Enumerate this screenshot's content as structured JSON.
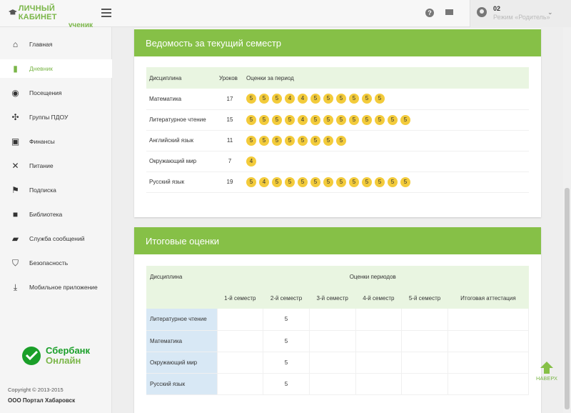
{
  "header": {
    "logo_line1": "ЛИЧНЫЙ КАБИНЕТ",
    "logo_line2": "ученик",
    "user_id": "02",
    "user_role": "Режим «Родитель»"
  },
  "sidebar": {
    "items": [
      {
        "label": "Главная",
        "icon": "home-icon"
      },
      {
        "label": "Дневник",
        "icon": "book-icon"
      },
      {
        "label": "Посещения",
        "icon": "attendance-icon"
      },
      {
        "label": "Группы ПДОУ",
        "icon": "groups-icon"
      },
      {
        "label": "Финансы",
        "icon": "wallet-icon"
      },
      {
        "label": "Питание",
        "icon": "food-icon"
      },
      {
        "label": "Подписка",
        "icon": "flag-icon"
      },
      {
        "label": "Библиотека",
        "icon": "library-icon"
      },
      {
        "label": "Служба сообщений",
        "icon": "messages-icon"
      },
      {
        "label": "Безопасность",
        "icon": "shield-icon"
      },
      {
        "label": "Мобильное приложение",
        "icon": "download-icon"
      }
    ],
    "active_index": 1,
    "sber_line1": "Сбербанк",
    "sber_line2": "Онлайн",
    "copyright": "Copyright © 2013-2015",
    "company": "ООО Портал Хабаровск"
  },
  "semester": {
    "title": "Ведомость за текущий семестр",
    "headers": [
      "Дисциплина",
      "Уроков",
      "Оценки за период"
    ],
    "rows": [
      {
        "subject": "Математика",
        "lessons": "17",
        "grades": [
          "5",
          "5",
          "5",
          "4",
          "4",
          "5",
          "5",
          "5",
          "5",
          "5",
          "5"
        ]
      },
      {
        "subject": "Литературное чтение",
        "lessons": "15",
        "grades": [
          "5",
          "5",
          "5",
          "5",
          "4",
          "5",
          "5",
          "5",
          "5",
          "5",
          "5",
          "5",
          "5"
        ]
      },
      {
        "subject": "Английский язык",
        "lessons": "11",
        "grades": [
          "5",
          "5",
          "5",
          "5",
          "5",
          "5",
          "5",
          "5"
        ]
      },
      {
        "subject": "Окружающий мир",
        "lessons": "7",
        "grades": [
          "4"
        ]
      },
      {
        "subject": "Русский язык",
        "lessons": "19",
        "grades": [
          "5",
          "4",
          "5",
          "5",
          "5",
          "5",
          "5",
          "5",
          "5",
          "5",
          "5",
          "5",
          "5"
        ]
      }
    ]
  },
  "final": {
    "title": "Итоговые оценки",
    "discipline_header": "Дисциплина",
    "periods_header": "Оценки периодов",
    "period_headers": [
      "1-й семестр",
      "2-й семестр",
      "3-й семестр",
      "4-й семестр",
      "5-й семестр",
      "Итоговая аттестация"
    ],
    "rows": [
      {
        "subject": "Литературное чтение",
        "cells": [
          "",
          "5",
          "",
          "",
          "",
          ""
        ]
      },
      {
        "subject": "Математика",
        "cells": [
          "",
          "5",
          "",
          "",
          "",
          ""
        ]
      },
      {
        "subject": "Окружающий мир",
        "cells": [
          "",
          "5",
          "",
          "",
          "",
          ""
        ]
      },
      {
        "subject": "Русский язык",
        "cells": [
          "",
          "5",
          "",
          "",
          "",
          ""
        ]
      }
    ]
  },
  "naverh_label": "НАВЕРХ"
}
